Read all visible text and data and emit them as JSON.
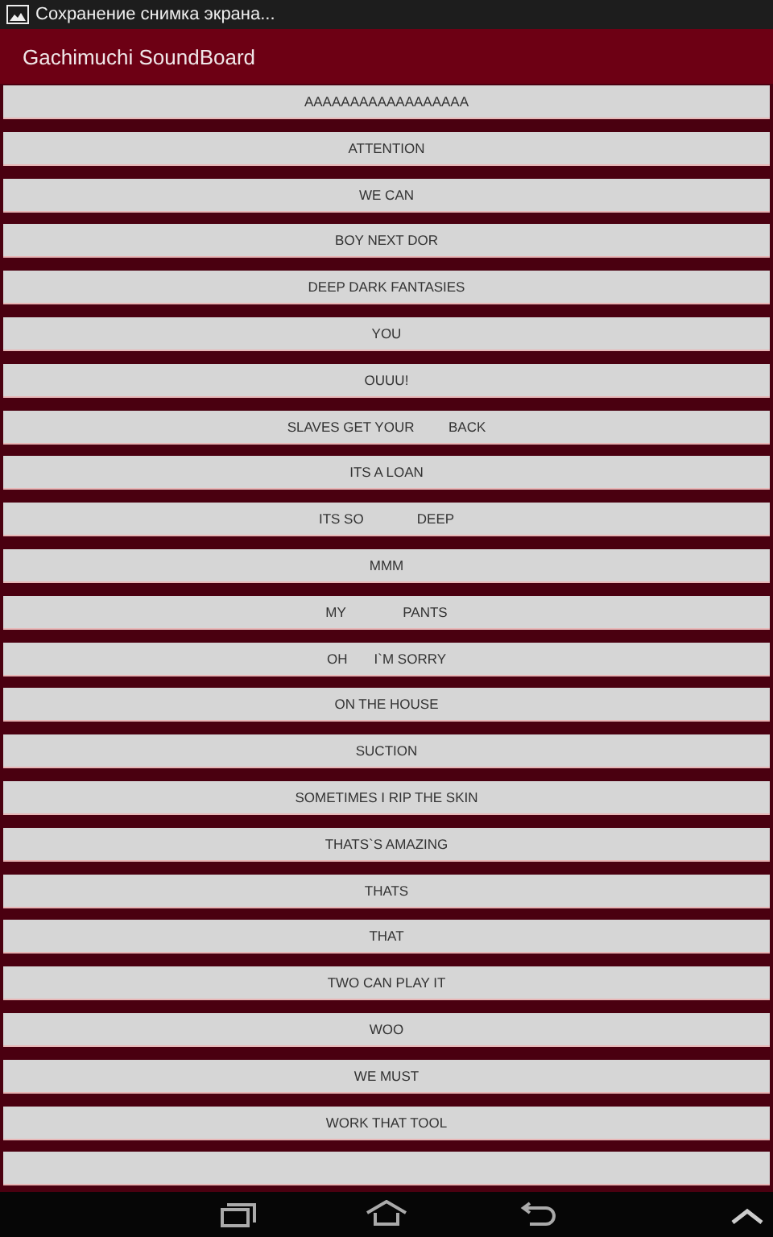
{
  "status_bar": {
    "notification": "Сохранение снимка экрана..."
  },
  "app_bar": {
    "title": "Gachimuchi SoundBoard"
  },
  "buttons": [
    {
      "kind": "sound",
      "label": "AAAAAAAAAAAAAAAAAA"
    },
    {
      "kind": "sound",
      "label": "ATTENTION"
    },
    {
      "kind": "sound",
      "label": "WE CAN"
    },
    {
      "kind": "sound",
      "label": "BOY NEXT DOR"
    },
    {
      "kind": "sound",
      "label": "DEEP DARK FANTASIES"
    },
    {
      "kind": "sound",
      "label": "YOU"
    },
    {
      "kind": "sound",
      "label": "OUUU!"
    },
    {
      "kind": "sound",
      "label": "SLAVES GET YOUR         BACK"
    },
    {
      "kind": "sound",
      "label": "ITS A LOAN"
    },
    {
      "kind": "sound",
      "label": "ITS SO              DEEP"
    },
    {
      "kind": "sound",
      "label": "MMM"
    },
    {
      "kind": "sound",
      "label": "MY               PANTS"
    },
    {
      "kind": "sound",
      "label": "OH       I`M SORRY"
    },
    {
      "kind": "sound",
      "label": "ON THE HOUSE"
    },
    {
      "kind": "sound",
      "label": "SUCTION"
    },
    {
      "kind": "sound",
      "label": "SOMETIMES I RIP THE SKIN"
    },
    {
      "kind": "sound",
      "label": "THATS`S AMAZING"
    },
    {
      "kind": "sound",
      "label": "THATS"
    },
    {
      "kind": "sound",
      "label": "THAT"
    },
    {
      "kind": "sound",
      "label": "TWO CAN PLAY IT"
    },
    {
      "kind": "sound",
      "label": "WOO"
    },
    {
      "kind": "sound",
      "label": "WE MUST"
    },
    {
      "kind": "sound",
      "label": "WORK THAT TOOL"
    },
    {
      "kind": "blank"
    }
  ]
}
